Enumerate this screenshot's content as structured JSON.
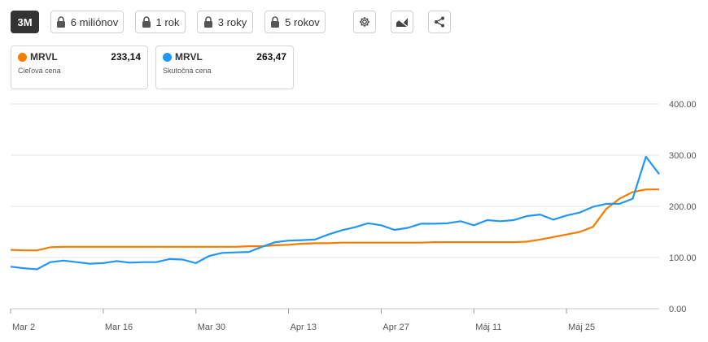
{
  "toolbar": {
    "range_3m": "3M",
    "range_6m": "6 miliónov",
    "range_1y": "1 rok",
    "range_3y": "3 roky",
    "range_5y": "5 rokov",
    "icons": [
      "settings-icon",
      "chart-type-icon",
      "share-icon"
    ],
    "active_color": "#333333"
  },
  "legend": [
    {
      "symbol": "MRVL",
      "value": "233,14",
      "label": "Cieľová cena",
      "color": "#f57c00"
    },
    {
      "symbol": "MRVL",
      "value": "263,47",
      "label": "Skutočná cena",
      "color": "#2196f3"
    }
  ],
  "chart_data": {
    "type": "line",
    "x_tick_labels": [
      "Mar 2",
      "Mar 16",
      "Mar 30",
      "Apr 13",
      "Apr 27",
      "Máj 11",
      "Máj 25"
    ],
    "y_tick_labels": [
      "400.00",
      "300.00",
      "200.00",
      "100.00",
      "0.00"
    ],
    "ylim": [
      0,
      400
    ],
    "grid": true,
    "x": [
      "2026-03-02",
      "2026-03-04",
      "2026-03-06",
      "2026-03-08",
      "2026-03-10",
      "2026-03-12",
      "2026-03-14",
      "2026-03-16",
      "2026-03-18",
      "2026-03-20",
      "2026-03-22",
      "2026-03-24",
      "2026-03-26",
      "2026-03-28",
      "2026-03-30",
      "2026-04-01",
      "2026-04-03",
      "2026-04-05",
      "2026-04-07",
      "2026-04-09",
      "2026-04-11",
      "2026-04-13",
      "2026-04-15",
      "2026-04-17",
      "2026-04-19",
      "2026-04-21",
      "2026-04-23",
      "2026-04-25",
      "2026-04-27",
      "2026-04-29",
      "2026-05-01",
      "2026-05-03",
      "2026-05-05",
      "2026-05-07",
      "2026-05-09",
      "2026-05-11",
      "2026-05-13",
      "2026-05-15",
      "2026-05-17",
      "2026-05-19",
      "2026-05-21",
      "2026-05-23",
      "2026-05-25",
      "2026-05-27",
      "2026-05-29",
      "2026-05-31",
      "2026-06-02",
      "2026-06-04",
      "2026-06-06",
      "2026-06-08"
    ],
    "series": [
      {
        "color": "#f57c00",
        "values": [
          115,
          114,
          114,
          120,
          121,
          121,
          121,
          121,
          121,
          121,
          121,
          121,
          121,
          121,
          121,
          121,
          121,
          121,
          122,
          122,
          124,
          125,
          127,
          128,
          128,
          129,
          129,
          129,
          129,
          129,
          129,
          129,
          130,
          130,
          130,
          130,
          130,
          130,
          130,
          131,
          135,
          140,
          145,
          150,
          160,
          195,
          215,
          228,
          233,
          233
        ]
      },
      {
        "color": "#2196f3",
        "values": [
          82,
          79,
          77,
          91,
          94,
          91,
          88,
          89,
          93,
          90,
          91,
          91,
          97,
          96,
          89,
          103,
          109,
          110,
          111,
          121,
          130,
          133,
          134,
          135,
          145,
          153,
          159,
          167,
          163,
          154,
          158,
          166,
          166,
          167,
          171,
          163,
          173,
          171,
          173,
          181,
          184,
          174,
          182,
          188,
          199,
          205,
          205,
          215,
          297,
          263
        ]
      }
    ]
  }
}
